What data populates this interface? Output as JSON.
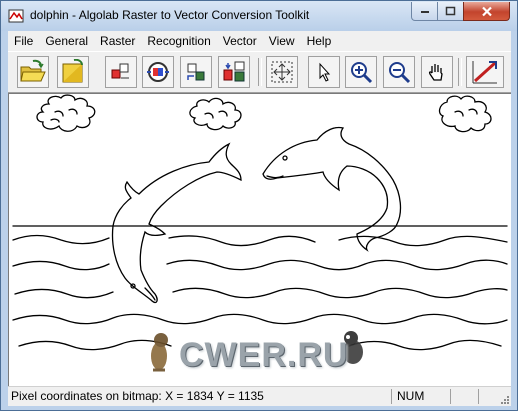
{
  "window": {
    "title": "dolphin - Algolab Raster to Vector Conversion Toolkit"
  },
  "menu": {
    "items": [
      {
        "label": "File"
      },
      {
        "label": "General"
      },
      {
        "label": "Raster"
      },
      {
        "label": "Recognition"
      },
      {
        "label": "Vector"
      },
      {
        "label": "View"
      },
      {
        "label": "Help"
      }
    ]
  },
  "toolbar": {
    "buttons": [
      {
        "icon": "open-folder-icon"
      },
      {
        "icon": "save-icon"
      },
      {
        "icon": "raster-to-vector-icon"
      },
      {
        "icon": "recognition-icon"
      },
      {
        "icon": "vector-edit-icon"
      },
      {
        "icon": "convert-icon"
      },
      {
        "icon": "fit-to-window-icon"
      },
      {
        "icon": "pointer-icon"
      },
      {
        "icon": "zoom-in-icon"
      },
      {
        "icon": "zoom-out-icon"
      },
      {
        "icon": "hand-pan-icon"
      },
      {
        "icon": "line-tool-icon"
      }
    ]
  },
  "watermark": "CWER.RU",
  "status": {
    "coordinates": "Pixel coordinates on bitmap:  X = 1834  Y = 1135",
    "num": "NUM"
  },
  "colors": {
    "titlebar": "#c4d6ee",
    "close_button": "#c3442d",
    "toolbar_bg": "#f0f0f0",
    "canvas_bg": "#ffffff"
  }
}
